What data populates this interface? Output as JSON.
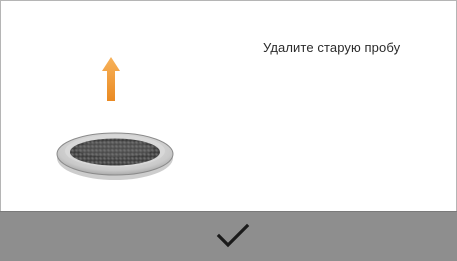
{
  "dialog": {
    "message": "Удалите старую пробу"
  },
  "illustration": {
    "arrow_color": "#f0962e",
    "dish_icon": "sample-pan-icon",
    "arrow_icon": "arrow-up-icon"
  },
  "confirm": {
    "icon": "checkmark-icon",
    "background_color": "#8e8e8e"
  }
}
